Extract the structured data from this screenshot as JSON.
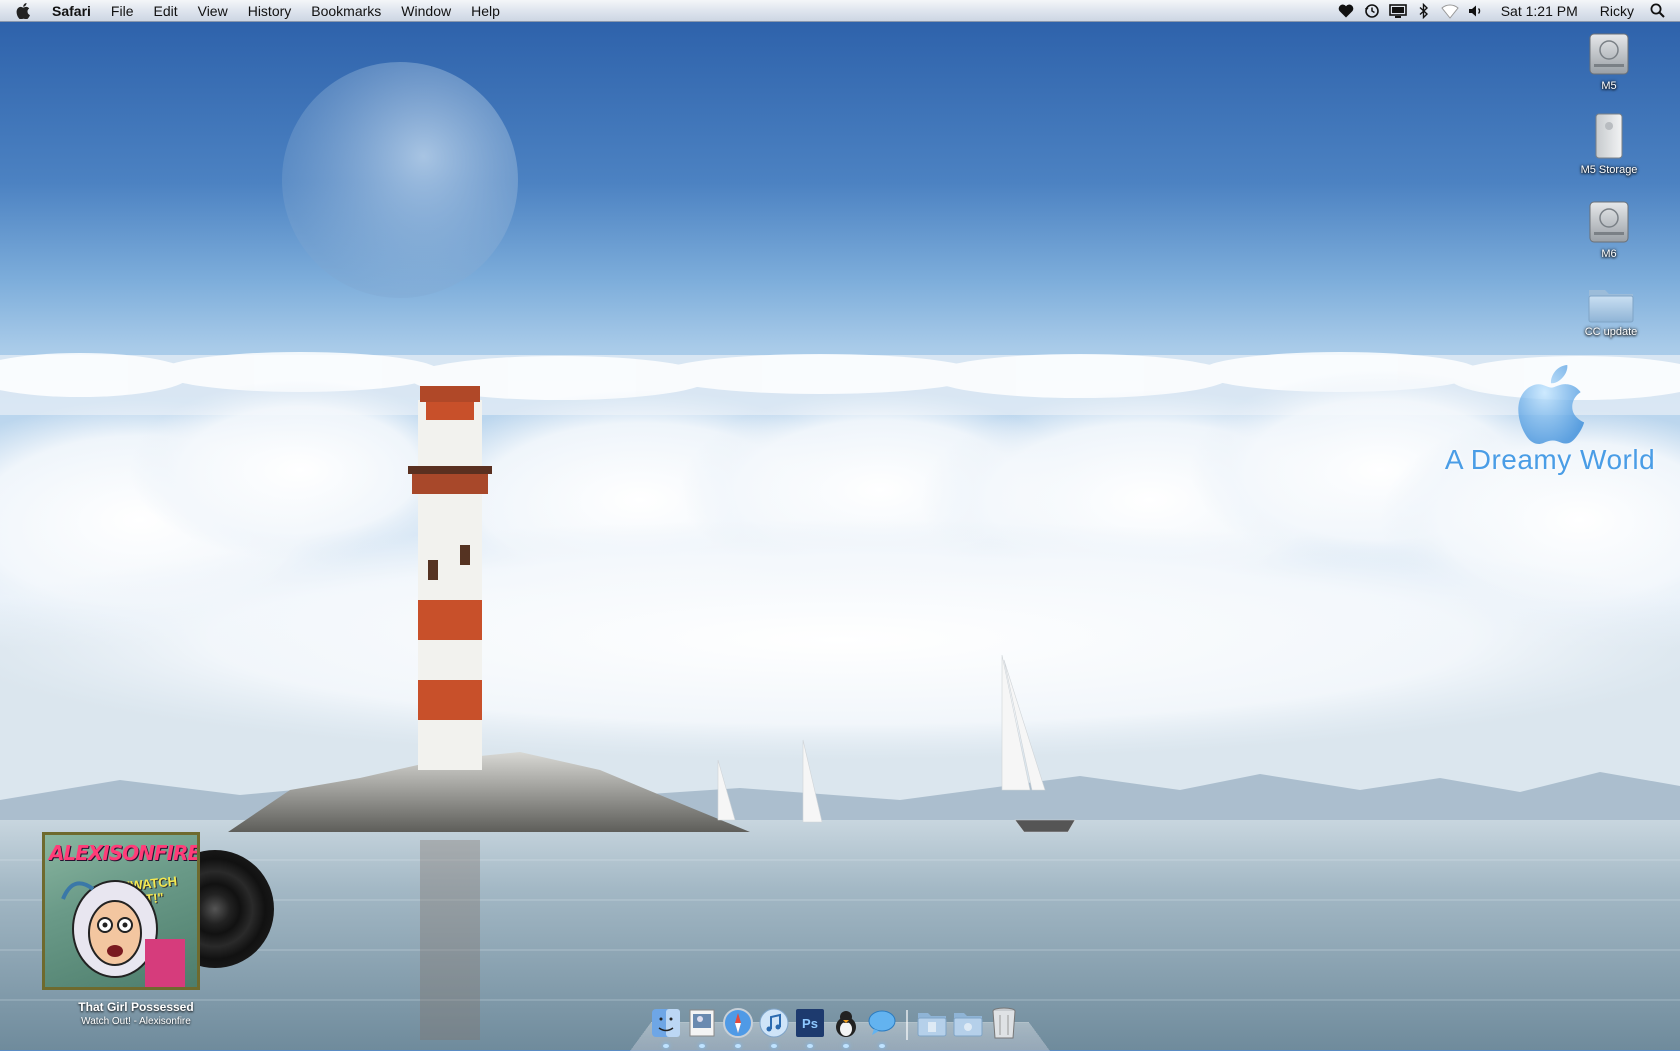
{
  "menubar": {
    "app_name": "Safari",
    "menus": [
      "File",
      "Edit",
      "View",
      "History",
      "Bookmarks",
      "Window",
      "Help"
    ],
    "status_icons": [
      "heart-icon",
      "time-machine-icon",
      "display-icon",
      "bluetooth-icon",
      "wifi-icon",
      "volume-icon"
    ],
    "clock": "Sat 1:21 PM",
    "user": "Ricky"
  },
  "desktop_icons": [
    {
      "label": "M5",
      "icon": "hard-drive-icon"
    },
    {
      "label": "M5 Storage",
      "icon": "external-drive-icon"
    },
    {
      "label": "M6",
      "icon": "hard-drive-icon"
    },
    {
      "label": "CC update",
      "icon": "folder-icon"
    }
  ],
  "wallpaper": {
    "watermark_text": "A Dreamy World"
  },
  "now_playing": {
    "band_art_text": "ALEXISONFIRE",
    "album_art_text": "\"WATCH OUT!\"",
    "track": "That Girl Possessed",
    "artist_line": "Watch Out! - Alexisonfire"
  },
  "dock": {
    "apps": [
      "finder-icon",
      "preview-icon",
      "safari-icon",
      "itunes-icon",
      "photoshop-icon",
      "adium-icon",
      "ichat-icon"
    ],
    "photoshop_label": "Ps",
    "stacks": [
      "documents-stack-icon",
      "pictures-stack-icon",
      "trash-icon"
    ]
  },
  "colors": {
    "sky_top": "#2e63ad",
    "sky_mid": "#7aa8d8",
    "water": "#8ea8b8",
    "lighthouse_red": "#c8502a"
  }
}
